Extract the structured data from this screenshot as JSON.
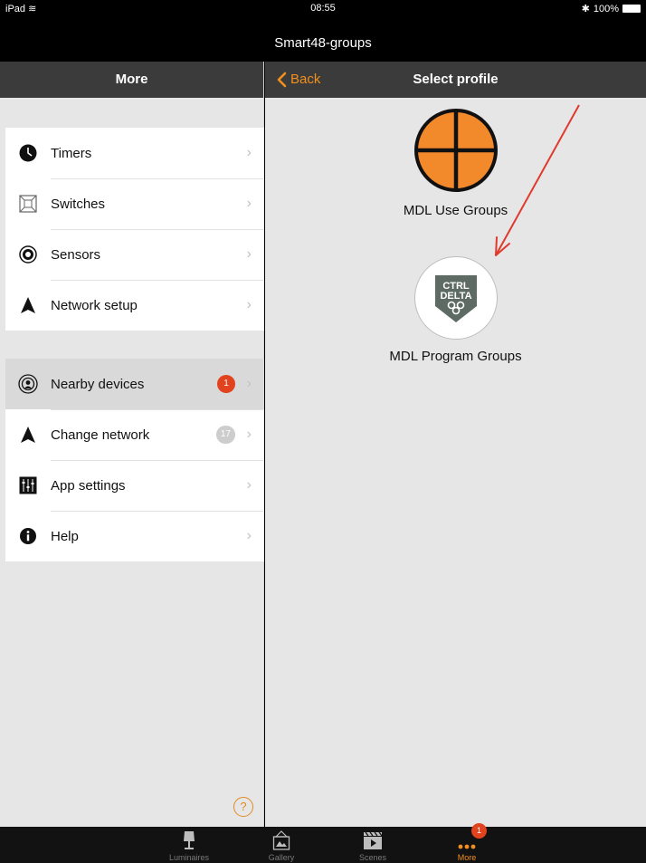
{
  "status_bar": {
    "device": "iPad",
    "time": "08:55",
    "battery": "100%"
  },
  "app_title": "Smart48-groups",
  "left_header": "More",
  "menu_group1": [
    {
      "label": "Timers",
      "icon": "clock-icon"
    },
    {
      "label": "Switches",
      "icon": "switch-icon"
    },
    {
      "label": "Sensors",
      "icon": "sensor-icon"
    },
    {
      "label": "Network setup",
      "icon": "network-icon"
    }
  ],
  "menu_group2": [
    {
      "label": "Nearby devices",
      "icon": "nearby-icon",
      "badge": "1"
    },
    {
      "label": "Change network",
      "icon": "network-icon",
      "badge": "17"
    },
    {
      "label": "App settings",
      "icon": "settings-icon"
    },
    {
      "label": "Help",
      "icon": "info-icon"
    }
  ],
  "help_glyph": "?",
  "right_header": {
    "back": "Back",
    "title": "Select profile"
  },
  "profiles": [
    {
      "label": "MDL Use Groups",
      "icon": "crosshair-icon"
    },
    {
      "label": "MDL Program Groups",
      "icon": "ctrl-delta-logo",
      "logo_text": [
        "CTRL",
        "DELTA"
      ]
    }
  ],
  "tabs": [
    {
      "label": "Luminaires",
      "icon": "lamp-icon"
    },
    {
      "label": "Gallery",
      "icon": "gallery-icon"
    },
    {
      "label": "Scenes",
      "icon": "clapper-icon"
    },
    {
      "label": "More",
      "icon": "more-icon",
      "badge": "1",
      "active": true
    }
  ],
  "colors": {
    "accent": "#f0901e",
    "badge_red": "#e1431e",
    "header": "#3b3b3b",
    "annotation_arrow": "#e03a2e"
  }
}
